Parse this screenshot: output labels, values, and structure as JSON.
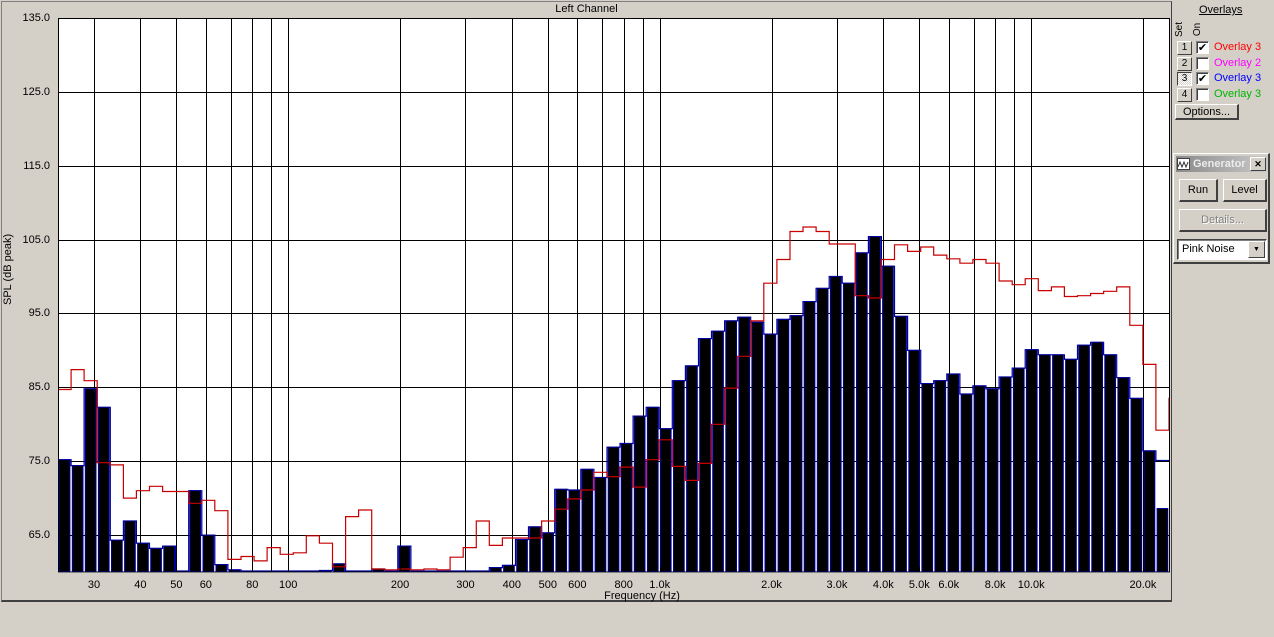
{
  "window": {
    "background": "#d4d0c8"
  },
  "chart": {
    "title": "Left Channel",
    "ylabel": "SPL (dB peak)",
    "xlabel": "Frequency (Hz)"
  },
  "chart_data": {
    "type": "bar",
    "title": "Left Channel",
    "xlabel": "Frequency (Hz)",
    "ylabel": "SPL (dB peak)",
    "x_scale": "log",
    "x_range_hz": [
      24,
      23500
    ],
    "ylim": [
      60,
      135
    ],
    "grid": true,
    "y_tick_labels": [
      "135.0",
      "125.0",
      "115.0",
      "105.0",
      "95.0",
      "85.0",
      "75.0",
      "65.0"
    ],
    "y_tick_values": [
      135,
      125,
      115,
      105,
      95,
      85,
      75,
      65
    ],
    "x_tick_labels": [
      "30",
      "40",
      "50",
      "60",
      "80",
      "100",
      "200",
      "300",
      "400",
      "500",
      "600",
      "800",
      "1.0k",
      "2.0k",
      "3.0k",
      "4.0k",
      "5.0k",
      "6.0k",
      "8.0k",
      "10.0k",
      "20.0k"
    ],
    "x_tick_freqs": [
      30,
      40,
      50,
      60,
      80,
      100,
      200,
      300,
      400,
      500,
      600,
      800,
      1000,
      2000,
      3000,
      4000,
      5000,
      6000,
      8000,
      10000,
      20000
    ],
    "x_gridline_freqs": [
      30,
      40,
      50,
      60,
      70,
      80,
      90,
      100,
      200,
      300,
      400,
      500,
      600,
      700,
      800,
      900,
      1000,
      2000,
      3000,
      4000,
      5000,
      6000,
      7000,
      8000,
      9000,
      10000,
      20000
    ],
    "bands": 85,
    "series": [
      {
        "name": "live-spectrum-bars",
        "style": "filled-bars",
        "fill": "#000000",
        "edge": "#00009c",
        "values": [
          75.2,
          74.4,
          84.8,
          82.3,
          64.3,
          66.9,
          63.9,
          63.2,
          63.5,
          60.0,
          71.0,
          65.0,
          61.0,
          60.3,
          60.0,
          60.0,
          60.0,
          60.0,
          60.0,
          60.0,
          60.2,
          61.1,
          60.0,
          60.0,
          60.4,
          60.0,
          63.5,
          60.0,
          60.0,
          60.0,
          60.0,
          60.0,
          60.0,
          60.6,
          60.9,
          64.4,
          66.1,
          65.3,
          71.2,
          71.1,
          73.9,
          72.8,
          76.9,
          77.4,
          81.1,
          82.3,
          79.4,
          85.9,
          87.9,
          91.6,
          92.6,
          94.0,
          94.5,
          93.8,
          92.2,
          94.2,
          94.7,
          96.6,
          98.4,
          100.0,
          99.1,
          103.2,
          105.4,
          101.4,
          94.6,
          90.0,
          85.5,
          85.9,
          86.8,
          84.1,
          85.2,
          84.8,
          86.4,
          87.6,
          90.1,
          89.4,
          89.4,
          88.8,
          90.7,
          91.1,
          89.4,
          86.3,
          83.5,
          76.4,
          68.6
        ]
      },
      {
        "name": "overlay-3-blue-step",
        "style": "step-line",
        "color": "#00009c",
        "values": [
          75.2,
          74.4,
          84.8,
          82.3,
          64.3,
          66.9,
          63.9,
          63.2,
          63.5,
          60.0,
          71.0,
          65.0,
          61.0,
          60.3,
          60.0,
          60.0,
          60.0,
          60.0,
          60.0,
          60.0,
          60.2,
          61.1,
          60.0,
          60.0,
          60.4,
          60.0,
          63.5,
          60.0,
          60.0,
          60.0,
          60.0,
          60.0,
          60.0,
          60.6,
          60.9,
          64.4,
          66.1,
          65.3,
          71.2,
          71.1,
          73.9,
          72.8,
          76.9,
          77.4,
          81.1,
          82.3,
          79.4,
          85.9,
          87.9,
          91.6,
          92.6,
          94.0,
          94.5,
          93.8,
          92.2,
          94.2,
          94.7,
          96.6,
          98.4,
          100.0,
          99.1,
          103.2,
          105.4,
          101.4,
          94.6,
          90.0,
          85.5,
          85.9,
          86.8,
          84.1,
          85.2,
          84.8,
          86.4,
          87.6,
          90.1,
          89.4,
          89.4,
          88.8,
          90.7,
          91.1,
          89.4,
          86.3,
          83.5,
          76.4,
          75.1
        ]
      },
      {
        "name": "overlay-1-red-step",
        "style": "step-line",
        "color": "#c80000",
        "final_tick": 83.6,
        "values": [
          84.7,
          87.4,
          85.9,
          74.8,
          74.5,
          70.0,
          71.0,
          71.6,
          70.9,
          70.9,
          69.3,
          69.7,
          68.3,
          61.7,
          62.1,
          61.5,
          63.3,
          62.4,
          62.6,
          64.9,
          63.9,
          60.7,
          67.5,
          68.4,
          60.4,
          60.3,
          60.4,
          60.3,
          60.4,
          60.3,
          62.0,
          63.3,
          66.9,
          63.6,
          64.6,
          64.6,
          64.6,
          66.9,
          68.5,
          69.9,
          71.1,
          73.5,
          72.9,
          74.2,
          71.5,
          75.2,
          77.9,
          74.3,
          72.4,
          74.7,
          80.0,
          84.9,
          89.2,
          94.0,
          99.1,
          102.3,
          106.1,
          106.7,
          106.1,
          104.4,
          104.4,
          97.4,
          97.1,
          102.3,
          104.3,
          103.4,
          104.0,
          102.9,
          102.4,
          101.8,
          102.3,
          101.8,
          99.4,
          98.9,
          99.7,
          98.1,
          98.6,
          97.3,
          97.4,
          97.7,
          98.0,
          98.6,
          93.4,
          88.1,
          79.2
        ]
      }
    ]
  },
  "overlays_panel": {
    "title": "Overlays",
    "set_label": "Set",
    "on_label": "On",
    "options_label": "Options...",
    "rows": [
      {
        "set": "1",
        "checked": true,
        "label": "Overlay 3",
        "color": "#ff0000",
        "active": false
      },
      {
        "set": "2",
        "checked": false,
        "label": "Overlay 2",
        "color": "#ff00ff",
        "active": false
      },
      {
        "set": "3",
        "checked": true,
        "label": "Overlay 3",
        "color": "#0000ff",
        "active": true
      },
      {
        "set": "4",
        "checked": false,
        "label": "Overlay 3",
        "color": "#00b400",
        "active": false
      }
    ]
  },
  "generator_window": {
    "title": "Generator",
    "run_label": "Run",
    "level_label": "Level",
    "details_label": "Details...",
    "noise_type": "Pink Noise"
  },
  "icons": {
    "close_glyph": "✕",
    "dropdown_arrow_glyph": "▼",
    "checkbox_check_glyph": "✔"
  }
}
